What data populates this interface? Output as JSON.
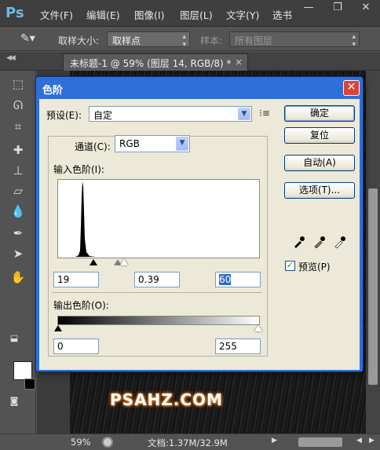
{
  "app": {
    "logo": "Ps",
    "menu": [
      "文件(F)",
      "编辑(E)",
      "图像(I)",
      "图层(L)",
      "文字(Y)",
      "选书"
    ],
    "window_controls": {
      "minimize": "—",
      "restore": "❐",
      "close": "✕"
    }
  },
  "options_bar": {
    "sample_size_label": "取样大小:",
    "sample_size_value": "取样点",
    "sample_label": "样本:",
    "sample_value": "所有图层"
  },
  "document_tab": {
    "title": "未标题-1 @ 59% (图层 14, RGB/8) *",
    "close": "×"
  },
  "tools": [
    "marquee-icon",
    "lasso-icon",
    "crop-icon",
    "healing-icon",
    "stamp-icon",
    "eraser-icon",
    "blur-icon",
    "pen-icon",
    "select-icon",
    "hand-icon"
  ],
  "colors": {
    "foreground": "#ffffff",
    "background": "#000000",
    "dialog_title": "#2e6fd9",
    "watermark_glow": "#e47d22"
  },
  "watermark": "PSAHZ.COM",
  "status_bar": {
    "zoom": "59%",
    "doc_info": "文档:1.37M/32.9M"
  },
  "levels_dialog": {
    "title": "色阶",
    "close": "✕",
    "preset_label": "预设(E):",
    "preset_value": "自定",
    "channel_label": "通道(C):",
    "channel_value": "RGB",
    "input_levels_label": "输入色阶(I):",
    "input_black": "19",
    "input_gamma": "0.39",
    "input_white": "60",
    "output_levels_label": "输出色阶(O):",
    "output_black": "0",
    "output_white": "255",
    "buttons": {
      "ok": "确定",
      "reset": "复位",
      "auto": "自动(A)",
      "options": "选项(T)..."
    },
    "preview_label": "预览(P)",
    "preview_checked": true
  }
}
